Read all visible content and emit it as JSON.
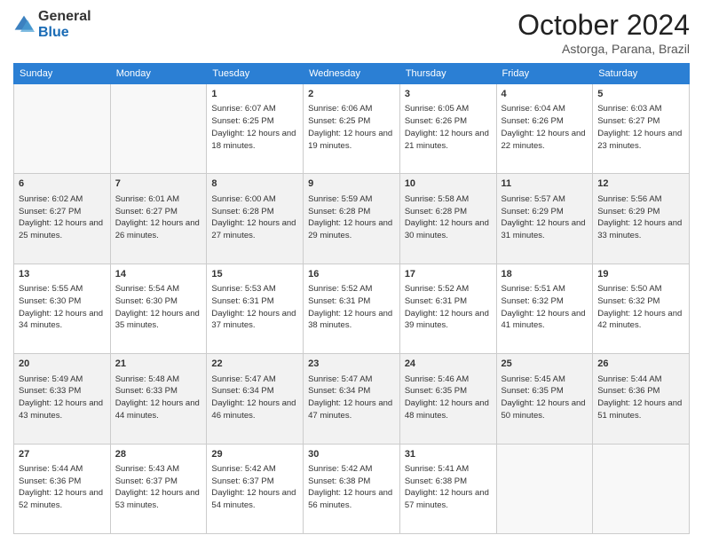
{
  "header": {
    "logo_line1": "General",
    "logo_line2": "Blue",
    "month": "October 2024",
    "location": "Astorga, Parana, Brazil"
  },
  "weekdays": [
    "Sunday",
    "Monday",
    "Tuesday",
    "Wednesday",
    "Thursday",
    "Friday",
    "Saturday"
  ],
  "weeks": [
    [
      {
        "day": "",
        "sunrise": "",
        "sunset": "",
        "daylight": ""
      },
      {
        "day": "",
        "sunrise": "",
        "sunset": "",
        "daylight": ""
      },
      {
        "day": "1",
        "sunrise": "Sunrise: 6:07 AM",
        "sunset": "Sunset: 6:25 PM",
        "daylight": "Daylight: 12 hours and 18 minutes."
      },
      {
        "day": "2",
        "sunrise": "Sunrise: 6:06 AM",
        "sunset": "Sunset: 6:25 PM",
        "daylight": "Daylight: 12 hours and 19 minutes."
      },
      {
        "day": "3",
        "sunrise": "Sunrise: 6:05 AM",
        "sunset": "Sunset: 6:26 PM",
        "daylight": "Daylight: 12 hours and 21 minutes."
      },
      {
        "day": "4",
        "sunrise": "Sunrise: 6:04 AM",
        "sunset": "Sunset: 6:26 PM",
        "daylight": "Daylight: 12 hours and 22 minutes."
      },
      {
        "day": "5",
        "sunrise": "Sunrise: 6:03 AM",
        "sunset": "Sunset: 6:27 PM",
        "daylight": "Daylight: 12 hours and 23 minutes."
      }
    ],
    [
      {
        "day": "6",
        "sunrise": "Sunrise: 6:02 AM",
        "sunset": "Sunset: 6:27 PM",
        "daylight": "Daylight: 12 hours and 25 minutes."
      },
      {
        "day": "7",
        "sunrise": "Sunrise: 6:01 AM",
        "sunset": "Sunset: 6:27 PM",
        "daylight": "Daylight: 12 hours and 26 minutes."
      },
      {
        "day": "8",
        "sunrise": "Sunrise: 6:00 AM",
        "sunset": "Sunset: 6:28 PM",
        "daylight": "Daylight: 12 hours and 27 minutes."
      },
      {
        "day": "9",
        "sunrise": "Sunrise: 5:59 AM",
        "sunset": "Sunset: 6:28 PM",
        "daylight": "Daylight: 12 hours and 29 minutes."
      },
      {
        "day": "10",
        "sunrise": "Sunrise: 5:58 AM",
        "sunset": "Sunset: 6:28 PM",
        "daylight": "Daylight: 12 hours and 30 minutes."
      },
      {
        "day": "11",
        "sunrise": "Sunrise: 5:57 AM",
        "sunset": "Sunset: 6:29 PM",
        "daylight": "Daylight: 12 hours and 31 minutes."
      },
      {
        "day": "12",
        "sunrise": "Sunrise: 5:56 AM",
        "sunset": "Sunset: 6:29 PM",
        "daylight": "Daylight: 12 hours and 33 minutes."
      }
    ],
    [
      {
        "day": "13",
        "sunrise": "Sunrise: 5:55 AM",
        "sunset": "Sunset: 6:30 PM",
        "daylight": "Daylight: 12 hours and 34 minutes."
      },
      {
        "day": "14",
        "sunrise": "Sunrise: 5:54 AM",
        "sunset": "Sunset: 6:30 PM",
        "daylight": "Daylight: 12 hours and 35 minutes."
      },
      {
        "day": "15",
        "sunrise": "Sunrise: 5:53 AM",
        "sunset": "Sunset: 6:31 PM",
        "daylight": "Daylight: 12 hours and 37 minutes."
      },
      {
        "day": "16",
        "sunrise": "Sunrise: 5:52 AM",
        "sunset": "Sunset: 6:31 PM",
        "daylight": "Daylight: 12 hours and 38 minutes."
      },
      {
        "day": "17",
        "sunrise": "Sunrise: 5:52 AM",
        "sunset": "Sunset: 6:31 PM",
        "daylight": "Daylight: 12 hours and 39 minutes."
      },
      {
        "day": "18",
        "sunrise": "Sunrise: 5:51 AM",
        "sunset": "Sunset: 6:32 PM",
        "daylight": "Daylight: 12 hours and 41 minutes."
      },
      {
        "day": "19",
        "sunrise": "Sunrise: 5:50 AM",
        "sunset": "Sunset: 6:32 PM",
        "daylight": "Daylight: 12 hours and 42 minutes."
      }
    ],
    [
      {
        "day": "20",
        "sunrise": "Sunrise: 5:49 AM",
        "sunset": "Sunset: 6:33 PM",
        "daylight": "Daylight: 12 hours and 43 minutes."
      },
      {
        "day": "21",
        "sunrise": "Sunrise: 5:48 AM",
        "sunset": "Sunset: 6:33 PM",
        "daylight": "Daylight: 12 hours and 44 minutes."
      },
      {
        "day": "22",
        "sunrise": "Sunrise: 5:47 AM",
        "sunset": "Sunset: 6:34 PM",
        "daylight": "Daylight: 12 hours and 46 minutes."
      },
      {
        "day": "23",
        "sunrise": "Sunrise: 5:47 AM",
        "sunset": "Sunset: 6:34 PM",
        "daylight": "Daylight: 12 hours and 47 minutes."
      },
      {
        "day": "24",
        "sunrise": "Sunrise: 5:46 AM",
        "sunset": "Sunset: 6:35 PM",
        "daylight": "Daylight: 12 hours and 48 minutes."
      },
      {
        "day": "25",
        "sunrise": "Sunrise: 5:45 AM",
        "sunset": "Sunset: 6:35 PM",
        "daylight": "Daylight: 12 hours and 50 minutes."
      },
      {
        "day": "26",
        "sunrise": "Sunrise: 5:44 AM",
        "sunset": "Sunset: 6:36 PM",
        "daylight": "Daylight: 12 hours and 51 minutes."
      }
    ],
    [
      {
        "day": "27",
        "sunrise": "Sunrise: 5:44 AM",
        "sunset": "Sunset: 6:36 PM",
        "daylight": "Daylight: 12 hours and 52 minutes."
      },
      {
        "day": "28",
        "sunrise": "Sunrise: 5:43 AM",
        "sunset": "Sunset: 6:37 PM",
        "daylight": "Daylight: 12 hours and 53 minutes."
      },
      {
        "day": "29",
        "sunrise": "Sunrise: 5:42 AM",
        "sunset": "Sunset: 6:37 PM",
        "daylight": "Daylight: 12 hours and 54 minutes."
      },
      {
        "day": "30",
        "sunrise": "Sunrise: 5:42 AM",
        "sunset": "Sunset: 6:38 PM",
        "daylight": "Daylight: 12 hours and 56 minutes."
      },
      {
        "day": "31",
        "sunrise": "Sunrise: 5:41 AM",
        "sunset": "Sunset: 6:38 PM",
        "daylight": "Daylight: 12 hours and 57 minutes."
      },
      {
        "day": "",
        "sunrise": "",
        "sunset": "",
        "daylight": ""
      },
      {
        "day": "",
        "sunrise": "",
        "sunset": "",
        "daylight": ""
      }
    ]
  ]
}
